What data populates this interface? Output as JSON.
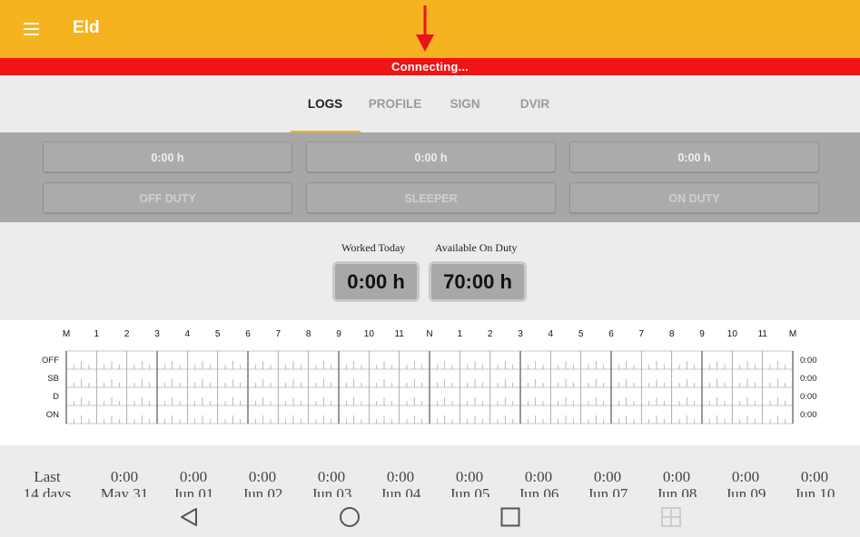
{
  "app": {
    "title": "Eld",
    "menu_icon": "hamburger-menu-icon"
  },
  "status": {
    "text": "Connecting..."
  },
  "tabs": [
    {
      "label": "LOGS",
      "active": true
    },
    {
      "label": "PROFILE",
      "active": false
    },
    {
      "label": "SIGN",
      "active": false
    },
    {
      "label": "DVIR",
      "active": false
    }
  ],
  "duty": {
    "off": {
      "time": "0:00 h",
      "label": "OFF DUTY"
    },
    "sleeper": {
      "time": "0:00 h",
      "label": "SLEEPER"
    },
    "on": {
      "time": "0:00 h",
      "label": "ON DUTY"
    }
  },
  "summary": {
    "worked_label": "Worked Today",
    "worked_value": "0:00 h",
    "available_label": "Available On Duty",
    "available_value": "70:00 h"
  },
  "log_grid": {
    "hour_labels": [
      "M",
      "1",
      "2",
      "3",
      "4",
      "5",
      "6",
      "7",
      "8",
      "9",
      "10",
      "11",
      "N",
      "1",
      "2",
      "3",
      "4",
      "5",
      "6",
      "7",
      "8",
      "9",
      "10",
      "11",
      "M"
    ],
    "rows": [
      {
        "label": "OFF",
        "total": "0:00"
      },
      {
        "label": "SB",
        "total": "0:00"
      },
      {
        "label": "D",
        "total": "0:00"
      },
      {
        "label": "ON",
        "total": "0:00"
      }
    ]
  },
  "history": {
    "label_line1": "Last",
    "label_line2": "14 days",
    "days": [
      {
        "value": "0:00",
        "date": "May 31"
      },
      {
        "value": "0:00",
        "date": "Jun 01"
      },
      {
        "value": "0:00",
        "date": "Jun 02"
      },
      {
        "value": "0:00",
        "date": "Jun 03"
      },
      {
        "value": "0:00",
        "date": "Jun 04"
      },
      {
        "value": "0:00",
        "date": "Jun 05"
      },
      {
        "value": "0:00",
        "date": "Jun 06"
      },
      {
        "value": "0:00",
        "date": "Jun 07"
      },
      {
        "value": "0:00",
        "date": "Jun 08"
      },
      {
        "value": "0:00",
        "date": "Jun 09"
      },
      {
        "value": "0:00",
        "date": "Jun 10"
      }
    ]
  },
  "colors": {
    "appbar": "#f5b320",
    "status_bar": "#f01414",
    "tab_indicator": "#f5b320"
  },
  "navbar": {
    "icons": [
      "back-icon",
      "home-icon",
      "recents-icon",
      "split-screen-icon"
    ]
  }
}
